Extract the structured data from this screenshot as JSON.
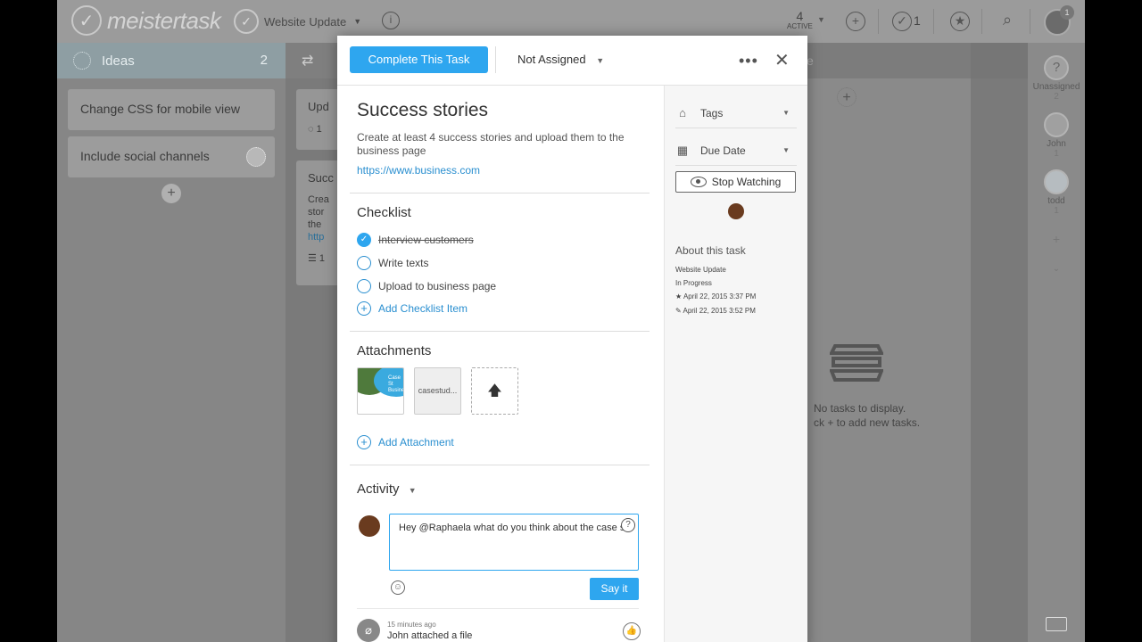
{
  "topbar": {
    "logo_text": "meistertask",
    "project_name": "Website Update",
    "active_count": "4",
    "active_label": "ACTIVE",
    "checks_count": "1",
    "notif_count": "1"
  },
  "board": {
    "ideas": {
      "title": "Ideas",
      "count": "2",
      "cards": [
        "Change CSS for mobile view",
        "Include social channels"
      ]
    },
    "in_progress": {
      "cards": [
        "Upd",
        "Succ"
      ],
      "partial_lines": [
        "Crea",
        "stor",
        "the",
        "http"
      ],
      "counts": [
        "1",
        "1"
      ]
    },
    "done": {
      "title_fragment": "e",
      "empty_text_1": "No tasks to display.",
      "empty_text_2": "ck + to add new tasks."
    }
  },
  "rail": {
    "items": [
      {
        "label": "Unassigned",
        "count": "2",
        "icon": "?"
      },
      {
        "label": "John",
        "count": "1",
        "icon": ""
      },
      {
        "label": "todd",
        "count": "1",
        "icon": ""
      }
    ]
  },
  "modal": {
    "complete_label": "Complete This Task",
    "assignee": "Not Assigned",
    "title": "Success stories",
    "description": "Create at least 4 success stories and upload them to the business page",
    "link": "https://www.business.com",
    "checklist_title": "Checklist",
    "checklist": [
      {
        "label": "Interview customers",
        "done": true
      },
      {
        "label": "Write texts",
        "done": false
      },
      {
        "label": "Upload to business page",
        "done": false
      }
    ],
    "add_checklist_label": "Add Checklist Item",
    "attachments_title": "Attachments",
    "attachments": [
      "Case St Busine",
      "casestud..."
    ],
    "add_attachment_label": "Add Attachment",
    "activity_title": "Activity",
    "comment_text": "Hey @Raphaela what do you think about the case s",
    "say_label": "Say it",
    "activity_item": {
      "time": "15 minutes ago",
      "text": "John attached a file"
    },
    "sidebar": {
      "tags_label": "Tags",
      "due_label": "Due Date",
      "watch_label": "Stop Watching",
      "about_title": "About this task",
      "about_lines": [
        "Website Update",
        "In Progress",
        "April 22, 2015 3:37 PM",
        "April 22, 2015 3:52 PM"
      ]
    }
  },
  "colors": {
    "accent": "#2ea6ef",
    "link": "#2a8fd0",
    "overlay": "#8c8c8c"
  }
}
